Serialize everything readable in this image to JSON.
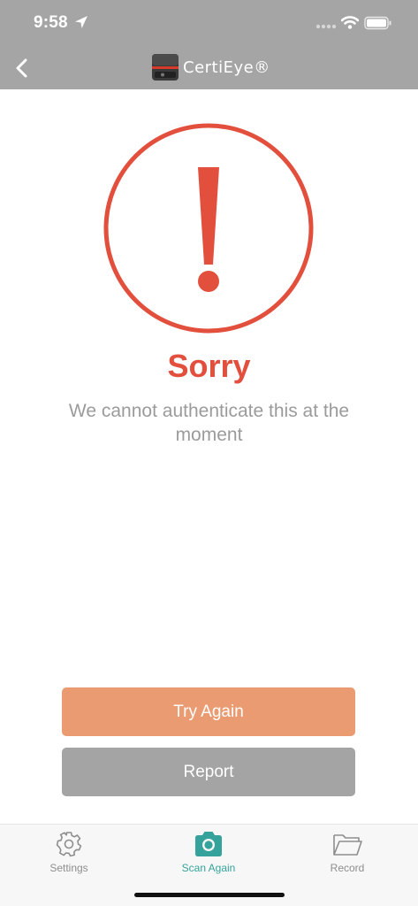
{
  "status_bar": {
    "time": "9:58",
    "icons": [
      "location-arrow-icon",
      "cellular-signal-icon",
      "wifi-icon",
      "battery-icon"
    ]
  },
  "header": {
    "back_icon": "chevron-left-icon",
    "brand_logo": "certieye-logo-icon",
    "brand_name": "CertiEye®",
    "background_color": "#a5a5a5"
  },
  "result": {
    "icon": "exclamation-circle-icon",
    "title": "Sorry",
    "message": "We cannot authenticate this at the moment",
    "accent_color": "#e34f3d"
  },
  "actions": {
    "try_again_label": "Try Again",
    "try_again_color": "#ea9b72",
    "report_label": "Report",
    "report_color": "#a4a4a4"
  },
  "tab_bar": {
    "active_color": "#35a39b",
    "items": [
      {
        "label": "Settings",
        "icon": "gear-icon",
        "active": false
      },
      {
        "label": "Scan Again",
        "icon": "camera-icon",
        "active": true
      },
      {
        "label": "Record",
        "icon": "folder-open-icon",
        "active": false
      }
    ]
  }
}
